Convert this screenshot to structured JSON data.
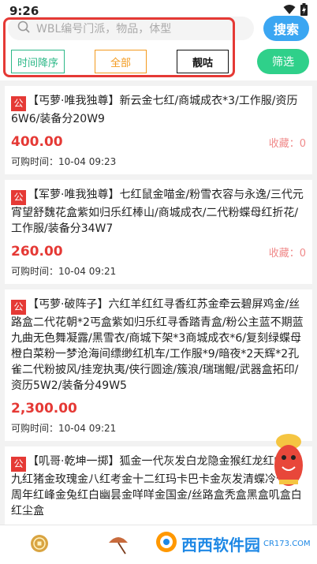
{
  "status_bar": {
    "time": "9:26"
  },
  "search": {
    "placeholder": "WBL编号门派，物品，体型",
    "button_label": "搜索"
  },
  "filters": {
    "sort": "时间降序",
    "all": "全部",
    "hot": "靓咕",
    "filter_button": "筛选"
  },
  "listings": [
    {
      "tag": "公",
      "desc": "【丐萝·唯我独尊】新云金七红/商城成衣*3/工作服/资历6W6/装备分20W9",
      "price": "400.00",
      "fav_label": "收藏：0",
      "time_label": "可购时间：",
      "time": "10-04 09:23"
    },
    {
      "tag": "公",
      "desc": "【军萝·唯我独尊】七红鼠金喵金/粉雪衣容与永逸/三代元宵望舒魏花盒紫如归乐红棒山/商城成衣/二代粉蝶母红折花/工作服/装备分34W7",
      "price": "260.00",
      "fav_label": "收藏：0",
      "time_label": "可购时间：",
      "time": "10-04 09:21"
    },
    {
      "tag": "公",
      "desc": "【丐萝·破阵子】六红羊红红寻香红苏金牵云碧屏鸡金/丝路盒二代花朝*2丐盒紫如归乐红寻香踏青盒/粉公主蓝不期蓝九曲无色舞凝露/黑雪衣/商城下架*3商城成衣*6/复刻绿蝶母橙白菜粉一梦沧海间缥缈红机车/工作服*9/暗夜*2天辉*2孔雀二代粉披风/挂宠执夷/侠行圆途/簇浪/瑞瑞鲲/武器盒拓印/资历5W2/装备分49W5",
      "price": "2,300.00",
      "fav_label": "",
      "time_label": "可购时间：",
      "time": "10-04 09:21"
    },
    {
      "tag": "公",
      "desc": "【叽哥·乾坤一掷】狐金一代灰发白龙隐金猴红龙红蛇红九红猪金玫瑰金八红考金十二红玛卡巴卡金灰发清蝶冷十五周年红峰金兔红白幽昙金咩咩金国金/丝路盒秃盒黑盒叽盒白红尘盒",
      "price": "",
      "fav_label": "",
      "time_label": "",
      "time": ""
    }
  ],
  "watermark": {
    "text": "西西软件园",
    "url": "CR173.COM"
  },
  "icons": [
    "search-icon",
    "wifi-icon",
    "battery-icon",
    "coin-icon",
    "umbrella-icon",
    "mascot-icon"
  ],
  "colors": {
    "accent_blue": "#3ba6f2",
    "accent_green": "#2fd08a",
    "price_red": "#e53935",
    "all_orange": "#f39a1f",
    "sort_green": "#2db888"
  }
}
